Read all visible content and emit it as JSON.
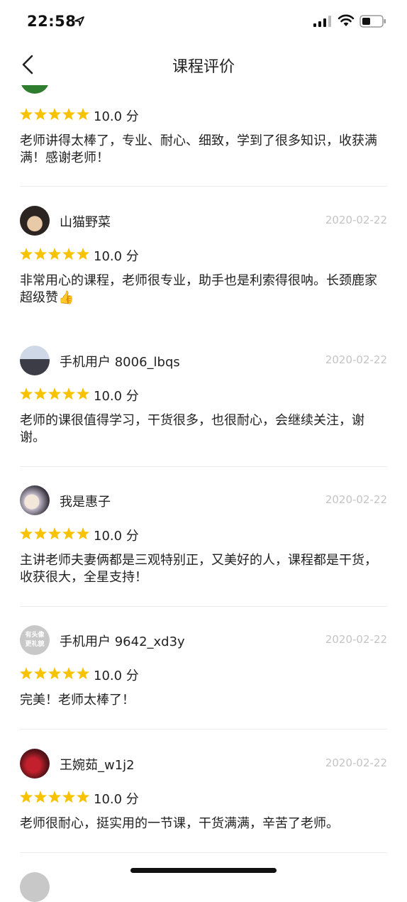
{
  "status": {
    "time": "22:58"
  },
  "nav": {
    "title": "课程评价"
  },
  "reviews": [
    {
      "user": "",
      "date": "",
      "score": "10.0 分",
      "content": "老师讲得太棒了，专业、耐心、细致，学到了很多知识，收获满满！感谢老师！"
    },
    {
      "user": "山猫野菜",
      "date": "2020-02-22",
      "score": "10.0 分",
      "content": "非常用心的课程，老师很专业，助手也是利索得很呐。长颈鹿家超级赞👍"
    },
    {
      "user": "手机用户 8006_lbqs",
      "date": "2020-02-22",
      "score": "10.0 分",
      "content": "老师的课很值得学习，干货很多，也很耐心，会继续关注，谢谢。"
    },
    {
      "user": "我是惠子",
      "date": "2020-02-22",
      "score": "10.0 分",
      "content": "主讲老师夫妻俩都是三观特别正，又美好的人，课程都是干货，收获很大，全星支持！"
    },
    {
      "user": "手机用户 9642_xd3y",
      "date": "2020-02-22",
      "score": "10.0 分",
      "content": "完美！老师太棒了！",
      "avatar_text": "有头像更礼貌"
    },
    {
      "user": "王婉茹_w1j2",
      "date": "2020-02-22",
      "score": "10.0 分",
      "content": "老师很耐心，挺实用的一节课，干货满满，辛苦了老师。"
    }
  ],
  "colors": {
    "star": "#F7C200",
    "date": "#C4C4C4",
    "divider": "#ECECEC"
  },
  "icons": [
    "back-chevron-icon",
    "star-icon",
    "location-arrow-icon",
    "signal-icon",
    "wifi-icon",
    "battery-icon"
  ]
}
